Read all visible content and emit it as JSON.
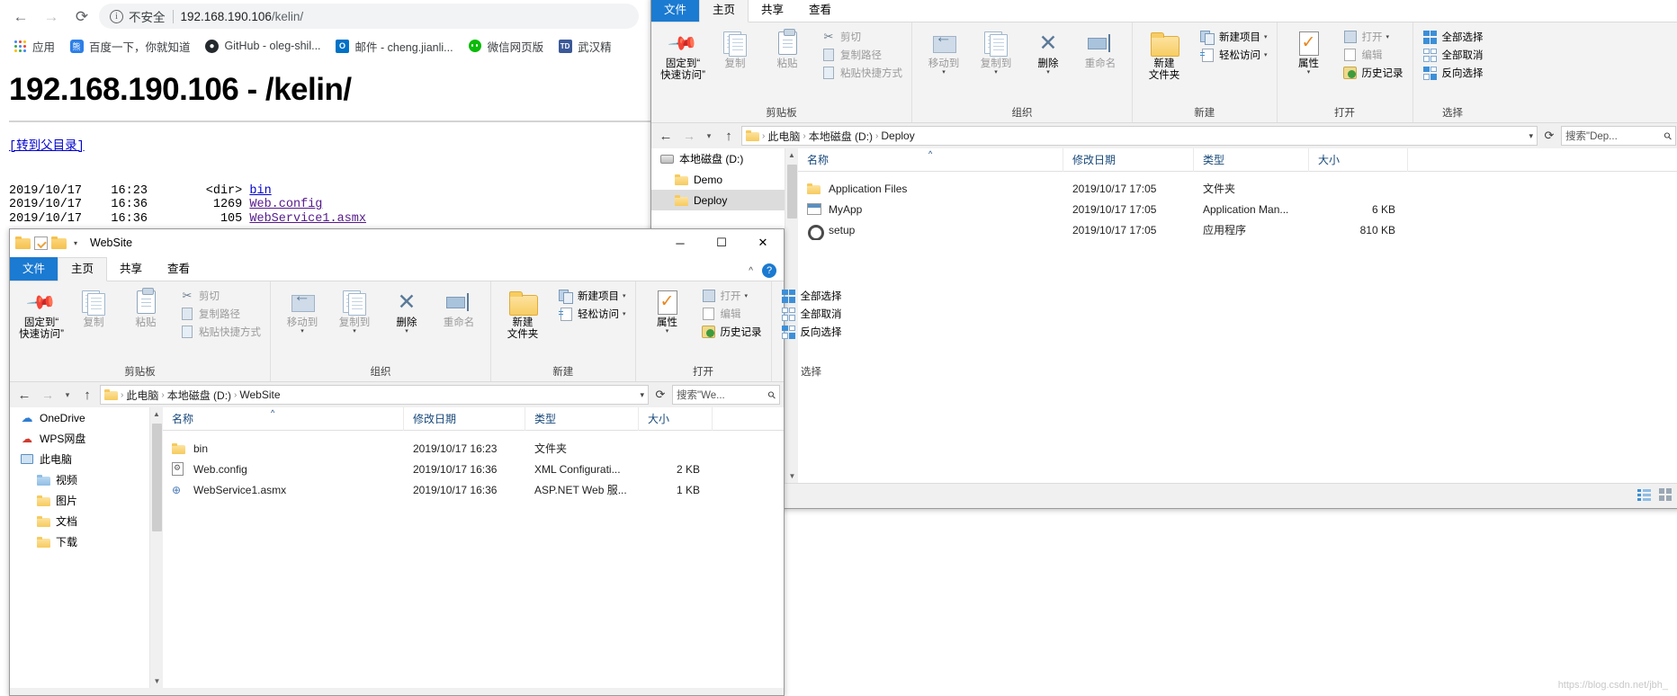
{
  "browser": {
    "back_icon": "←",
    "forward_icon": "→",
    "reload_icon": "⟳",
    "security_label": "不安全",
    "url_host": "192.168.190.106",
    "url_path": "/kelin/",
    "bookmarks": [
      {
        "label": "应用",
        "icon": "apps-grid-icon"
      },
      {
        "label": "百度一下，你就知道",
        "icon": "baidu-icon"
      },
      {
        "label": "GitHub - oleg-shil...",
        "icon": "github-icon"
      },
      {
        "label": "邮件 - cheng.jianli...",
        "icon": "outlook-icon"
      },
      {
        "label": "微信网页版",
        "icon": "wechat-icon"
      },
      {
        "label": "武汉精",
        "icon": "td-icon"
      }
    ]
  },
  "page": {
    "title": "192.168.190.106 - /kelin/",
    "parent_link": "[转到父目录]",
    "listing": [
      {
        "date": "2019/10/17",
        "time": "16:23",
        "size": "<dir>",
        "name": "bin",
        "visited": false
      },
      {
        "date": "2019/10/17",
        "time": "16:36",
        "size": "1269",
        "name": "Web.config",
        "visited": true
      },
      {
        "date": "2019/10/17",
        "time": "16:36",
        "size": "105",
        "name": "WebService1.asmx",
        "visited": true
      }
    ]
  },
  "ribbon": {
    "tabs": [
      {
        "label": "文件",
        "kind": "file"
      },
      {
        "label": "主页",
        "kind": "active"
      },
      {
        "label": "共享",
        "kind": "normal"
      },
      {
        "label": "查看",
        "kind": "normal"
      }
    ],
    "groups": [
      {
        "label": "剪贴板",
        "big": [
          {
            "label": "固定到“\n快速访问”",
            "icon": "pin-icon",
            "dim": false,
            "caret": false
          },
          {
            "label": "复制",
            "icon": "copy-icon",
            "dim": true,
            "caret": false
          },
          {
            "label": "粘贴",
            "icon": "paste-icon",
            "dim": true,
            "caret": false
          }
        ],
        "small": [
          {
            "label": "剪切",
            "icon": "scissors-icon",
            "dim": true
          },
          {
            "label": "复制路径",
            "icon": "copy-path-icon",
            "dim": true
          },
          {
            "label": "粘贴快捷方式",
            "icon": "paste-shortcut-icon",
            "dim": true
          }
        ]
      },
      {
        "label": "组织",
        "big": [
          {
            "label": "移动到",
            "icon": "move-to-icon",
            "dim": true,
            "caret": true
          },
          {
            "label": "复制到",
            "icon": "copy-to-icon",
            "dim": true,
            "caret": true
          },
          {
            "label": "删除",
            "icon": "delete-icon",
            "dim": false,
            "caret": true
          },
          {
            "label": "重命名",
            "icon": "rename-icon",
            "dim": true,
            "caret": false
          }
        ],
        "small": []
      },
      {
        "label": "新建",
        "big": [
          {
            "label": "新建\n文件夹",
            "icon": "new-folder-icon",
            "dim": false,
            "caret": false
          }
        ],
        "small": [
          {
            "label": "新建项目",
            "icon": "new-item-icon",
            "dim": false,
            "caret": true
          },
          {
            "label": "轻松访问",
            "icon": "easy-access-icon",
            "dim": false,
            "caret": true
          }
        ]
      },
      {
        "label": "打开",
        "big": [
          {
            "label": "属性",
            "icon": "properties-icon",
            "dim": false,
            "caret": true
          }
        ],
        "small": [
          {
            "label": "打开",
            "icon": "open-icon",
            "dim": true,
            "caret": true
          },
          {
            "label": "编辑",
            "icon": "edit-icon",
            "dim": true
          },
          {
            "label": "历史记录",
            "icon": "history-icon",
            "dim": false
          }
        ]
      },
      {
        "label": "选择",
        "big": [],
        "small": [
          {
            "label": "全部选择",
            "icon": "select-all-icon",
            "dim": false
          },
          {
            "label": "全部取消",
            "icon": "select-none-icon",
            "dim": false
          },
          {
            "label": "反向选择",
            "icon": "invert-selection-icon",
            "dim": false
          }
        ]
      }
    ]
  },
  "deploy_window": {
    "address": {
      "crumbs": [
        "此电脑",
        "本地磁盘 (D:)",
        "Deploy"
      ],
      "search_placeholder": "搜索\"Dep..."
    },
    "nav_pane": [
      {
        "label": "本地磁盘 (D:)",
        "icon": "drive-icon",
        "indent": 0,
        "state": "none"
      },
      {
        "label": "Demo",
        "icon": "folder-icon",
        "indent": 1,
        "state": "none"
      },
      {
        "label": "Deploy",
        "icon": "folder-icon",
        "indent": 1,
        "state": "selected-grey"
      }
    ],
    "columns": [
      "名称",
      "修改日期",
      "类型",
      "大小"
    ],
    "rows": [
      {
        "name": "Application Files",
        "icon": "folder-icon",
        "date": "2019/10/17 17:05",
        "type": "文件夹",
        "size": ""
      },
      {
        "name": "MyApp",
        "icon": "manifest-icon",
        "date": "2019/10/17 17:05",
        "type": "Application Man...",
        "size": "6 KB"
      },
      {
        "name": "setup",
        "icon": "application-icon",
        "date": "2019/10/17 17:05",
        "type": "应用程序",
        "size": "810 KB"
      }
    ]
  },
  "website_window": {
    "title": "WebSite",
    "window_controls": {
      "minimize": "─",
      "maximize": "☐",
      "close": "✕"
    },
    "ribbon_collapse": "^",
    "help": "?",
    "address": {
      "crumbs": [
        "此电脑",
        "本地磁盘 (D:)",
        "WebSite"
      ],
      "search_placeholder": "搜索\"We..."
    },
    "nav_pane": [
      {
        "label": "OneDrive",
        "icon": "cloud-icon",
        "indent": 0
      },
      {
        "label": "WPS网盘",
        "icon": "wps-cloud-icon",
        "indent": 0
      },
      {
        "label": "此电脑",
        "icon": "this-pc-icon",
        "indent": 0
      },
      {
        "label": "视频",
        "icon": "videos-folder-icon",
        "indent": 1
      },
      {
        "label": "图片",
        "icon": "pictures-folder-icon",
        "indent": 1
      },
      {
        "label": "文档",
        "icon": "documents-folder-icon",
        "indent": 1
      },
      {
        "label": "下载",
        "icon": "downloads-folder-icon",
        "indent": 1
      }
    ],
    "columns": [
      "名称",
      "修改日期",
      "类型",
      "大小"
    ],
    "rows": [
      {
        "name": "bin",
        "icon": "folder-icon",
        "date": "2019/10/17 16:23",
        "type": "文件夹",
        "size": ""
      },
      {
        "name": "Web.config",
        "icon": "xml-config-icon",
        "date": "2019/10/17 16:36",
        "type": "XML Configurati...",
        "size": "2 KB"
      },
      {
        "name": "WebService1.asmx",
        "icon": "asmx-icon",
        "date": "2019/10/17 16:36",
        "type": "ASP.NET Web 服...",
        "size": "1 KB"
      }
    ]
  },
  "watermark": "https://blog.csdn.net/jbh_"
}
